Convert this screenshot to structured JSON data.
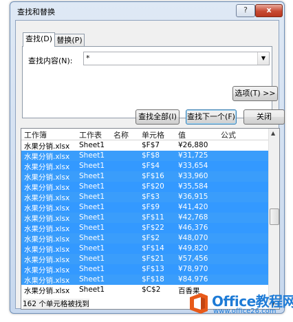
{
  "window": {
    "title": "查找和替换",
    "help_label": "?",
    "close_label": "x"
  },
  "tabs": [
    {
      "label": "查找(D)"
    },
    {
      "label": "替换(P)"
    }
  ],
  "find": {
    "label": "查找内容(N):",
    "value": "*"
  },
  "buttons": {
    "options": "选项(T) >>",
    "find_all": "查找全部(I)",
    "find_next": "查找下一个(F)",
    "close": "关闭"
  },
  "results": {
    "headers": [
      "工作簿",
      "工作表",
      "名称",
      "单元格",
      "值",
      "公式"
    ],
    "rows": [
      {
        "workbook": "水果分销.xlsx",
        "sheet": "Sheet1",
        "name": "",
        "cell": "$F$7",
        "value": "¥26,880",
        "formula": "",
        "selected": false
      },
      {
        "workbook": "水果分销.xlsx",
        "sheet": "Sheet1",
        "name": "",
        "cell": "$F$8",
        "value": "¥31,725",
        "formula": "",
        "selected": true
      },
      {
        "workbook": "水果分销.xlsx",
        "sheet": "Sheet1",
        "name": "",
        "cell": "$F$4",
        "value": "¥33,654",
        "formula": "",
        "selected": true
      },
      {
        "workbook": "水果分销.xlsx",
        "sheet": "Sheet1",
        "name": "",
        "cell": "$F$16",
        "value": "¥33,960",
        "formula": "",
        "selected": true
      },
      {
        "workbook": "水果分销.xlsx",
        "sheet": "Sheet1",
        "name": "",
        "cell": "$F$20",
        "value": "¥35,584",
        "formula": "",
        "selected": true
      },
      {
        "workbook": "水果分销.xlsx",
        "sheet": "Sheet1",
        "name": "",
        "cell": "$F$3",
        "value": "¥36,915",
        "formula": "",
        "selected": true
      },
      {
        "workbook": "水果分销.xlsx",
        "sheet": "Sheet1",
        "name": "",
        "cell": "$F$9",
        "value": "¥41,420",
        "formula": "",
        "selected": true
      },
      {
        "workbook": "水果分销.xlsx",
        "sheet": "Sheet1",
        "name": "",
        "cell": "$F$11",
        "value": "¥42,768",
        "formula": "",
        "selected": true
      },
      {
        "workbook": "水果分销.xlsx",
        "sheet": "Sheet1",
        "name": "",
        "cell": "$F$22",
        "value": "¥46,376",
        "formula": "",
        "selected": true
      },
      {
        "workbook": "水果分销.xlsx",
        "sheet": "Sheet1",
        "name": "",
        "cell": "$F$2",
        "value": "¥48,070",
        "formula": "",
        "selected": true
      },
      {
        "workbook": "水果分销.xlsx",
        "sheet": "Sheet1",
        "name": "",
        "cell": "$F$14",
        "value": "¥49,820",
        "formula": "",
        "selected": true
      },
      {
        "workbook": "水果分销.xlsx",
        "sheet": "Sheet1",
        "name": "",
        "cell": "$F$21",
        "value": "¥57,456",
        "formula": "",
        "selected": true
      },
      {
        "workbook": "水果分销.xlsx",
        "sheet": "Sheet1",
        "name": "",
        "cell": "$F$13",
        "value": "¥78,970",
        "formula": "",
        "selected": true
      },
      {
        "workbook": "水果分销.xlsx",
        "sheet": "Sheet1",
        "name": "",
        "cell": "$F$18",
        "value": "¥84,976",
        "formula": "",
        "selected": true
      },
      {
        "workbook": "水果分销.xlsx",
        "sheet": "Sheet1",
        "name": "",
        "cell": "$C$2",
        "value": "百香果",
        "formula": "",
        "selected": false
      }
    ],
    "status": "162 个单元格被找到"
  },
  "watermark": {
    "title": "Office教程网",
    "url": "www.office26.com"
  },
  "colors": {
    "selection": "#3399ff",
    "watermark": "#1e7bd6",
    "close_button": "#c74a33"
  }
}
